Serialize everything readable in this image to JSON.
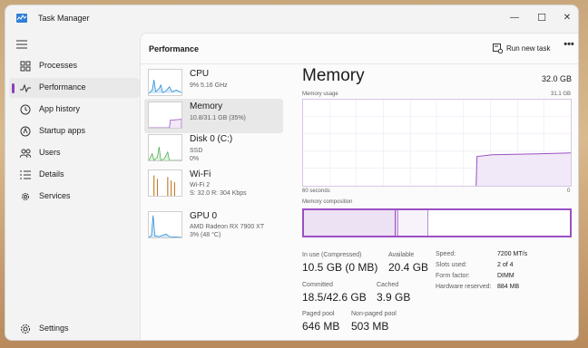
{
  "window": {
    "title": "Task Manager",
    "minimize": "—",
    "maximize": "☐",
    "close": "✕"
  },
  "sidebar": {
    "items": [
      {
        "label": "Processes"
      },
      {
        "label": "Performance"
      },
      {
        "label": "App history"
      },
      {
        "label": "Startup apps"
      },
      {
        "label": "Users"
      },
      {
        "label": "Details"
      },
      {
        "label": "Services"
      }
    ],
    "settings": "Settings"
  },
  "header": {
    "title": "Performance",
    "run_new_task": "Run new task",
    "more": "•••"
  },
  "perf_list": [
    {
      "name": "CPU",
      "sub1": "9%  5.16 GHz",
      "sub2": ""
    },
    {
      "name": "Memory",
      "sub1": "10.8/31.1 GB (35%)",
      "sub2": ""
    },
    {
      "name": "Disk 0 (C:)",
      "sub1": "SSD",
      "sub2": "0%"
    },
    {
      "name": "Wi-Fi",
      "sub1": "Wi-Fi 2",
      "sub2": "S: 32.0  R: 304 Kbps"
    },
    {
      "name": "GPU 0",
      "sub1": "AMD Radeon RX 7900 XT",
      "sub2": "3%  (48 °C)"
    }
  ],
  "detail": {
    "title": "Memory",
    "total": "32.0 GB",
    "usage_label": "Memory usage",
    "usage_max": "31.1 GB",
    "time_label": "60 seconds",
    "time_zero": "0",
    "composition_label": "Memory composition",
    "usage_level_fraction": 0.35
  },
  "stats": {
    "in_use_label": "In use (Compressed)",
    "in_use_value": "10.5 GB (0 MB)",
    "available_label": "Available",
    "available_value": "20.4 GB",
    "committed_label": "Committed",
    "committed_value": "18.5/42.6 GB",
    "cached_label": "Cached",
    "cached_value": "3.9 GB",
    "paged_label": "Paged pool",
    "paged_value": "646 MB",
    "nonpaged_label": "Non-paged pool",
    "nonpaged_value": "503 MB"
  },
  "specs": [
    {
      "label": "Speed:",
      "value": "7200 MT/s"
    },
    {
      "label": "Slots used:",
      "value": "2 of 4"
    },
    {
      "label": "Form factor:",
      "value": "DIMM"
    },
    {
      "label": "Hardware reserved:",
      "value": "884 MB"
    }
  ],
  "colors": {
    "accent": "#8a3fbf",
    "memory_fill": "#f1e9f7",
    "memory_line": "#9b4fc3",
    "cpu": "#1a8ad4",
    "disk": "#4caf50",
    "wifi": "#c47a2a",
    "gpu": "#1a8ad4"
  }
}
